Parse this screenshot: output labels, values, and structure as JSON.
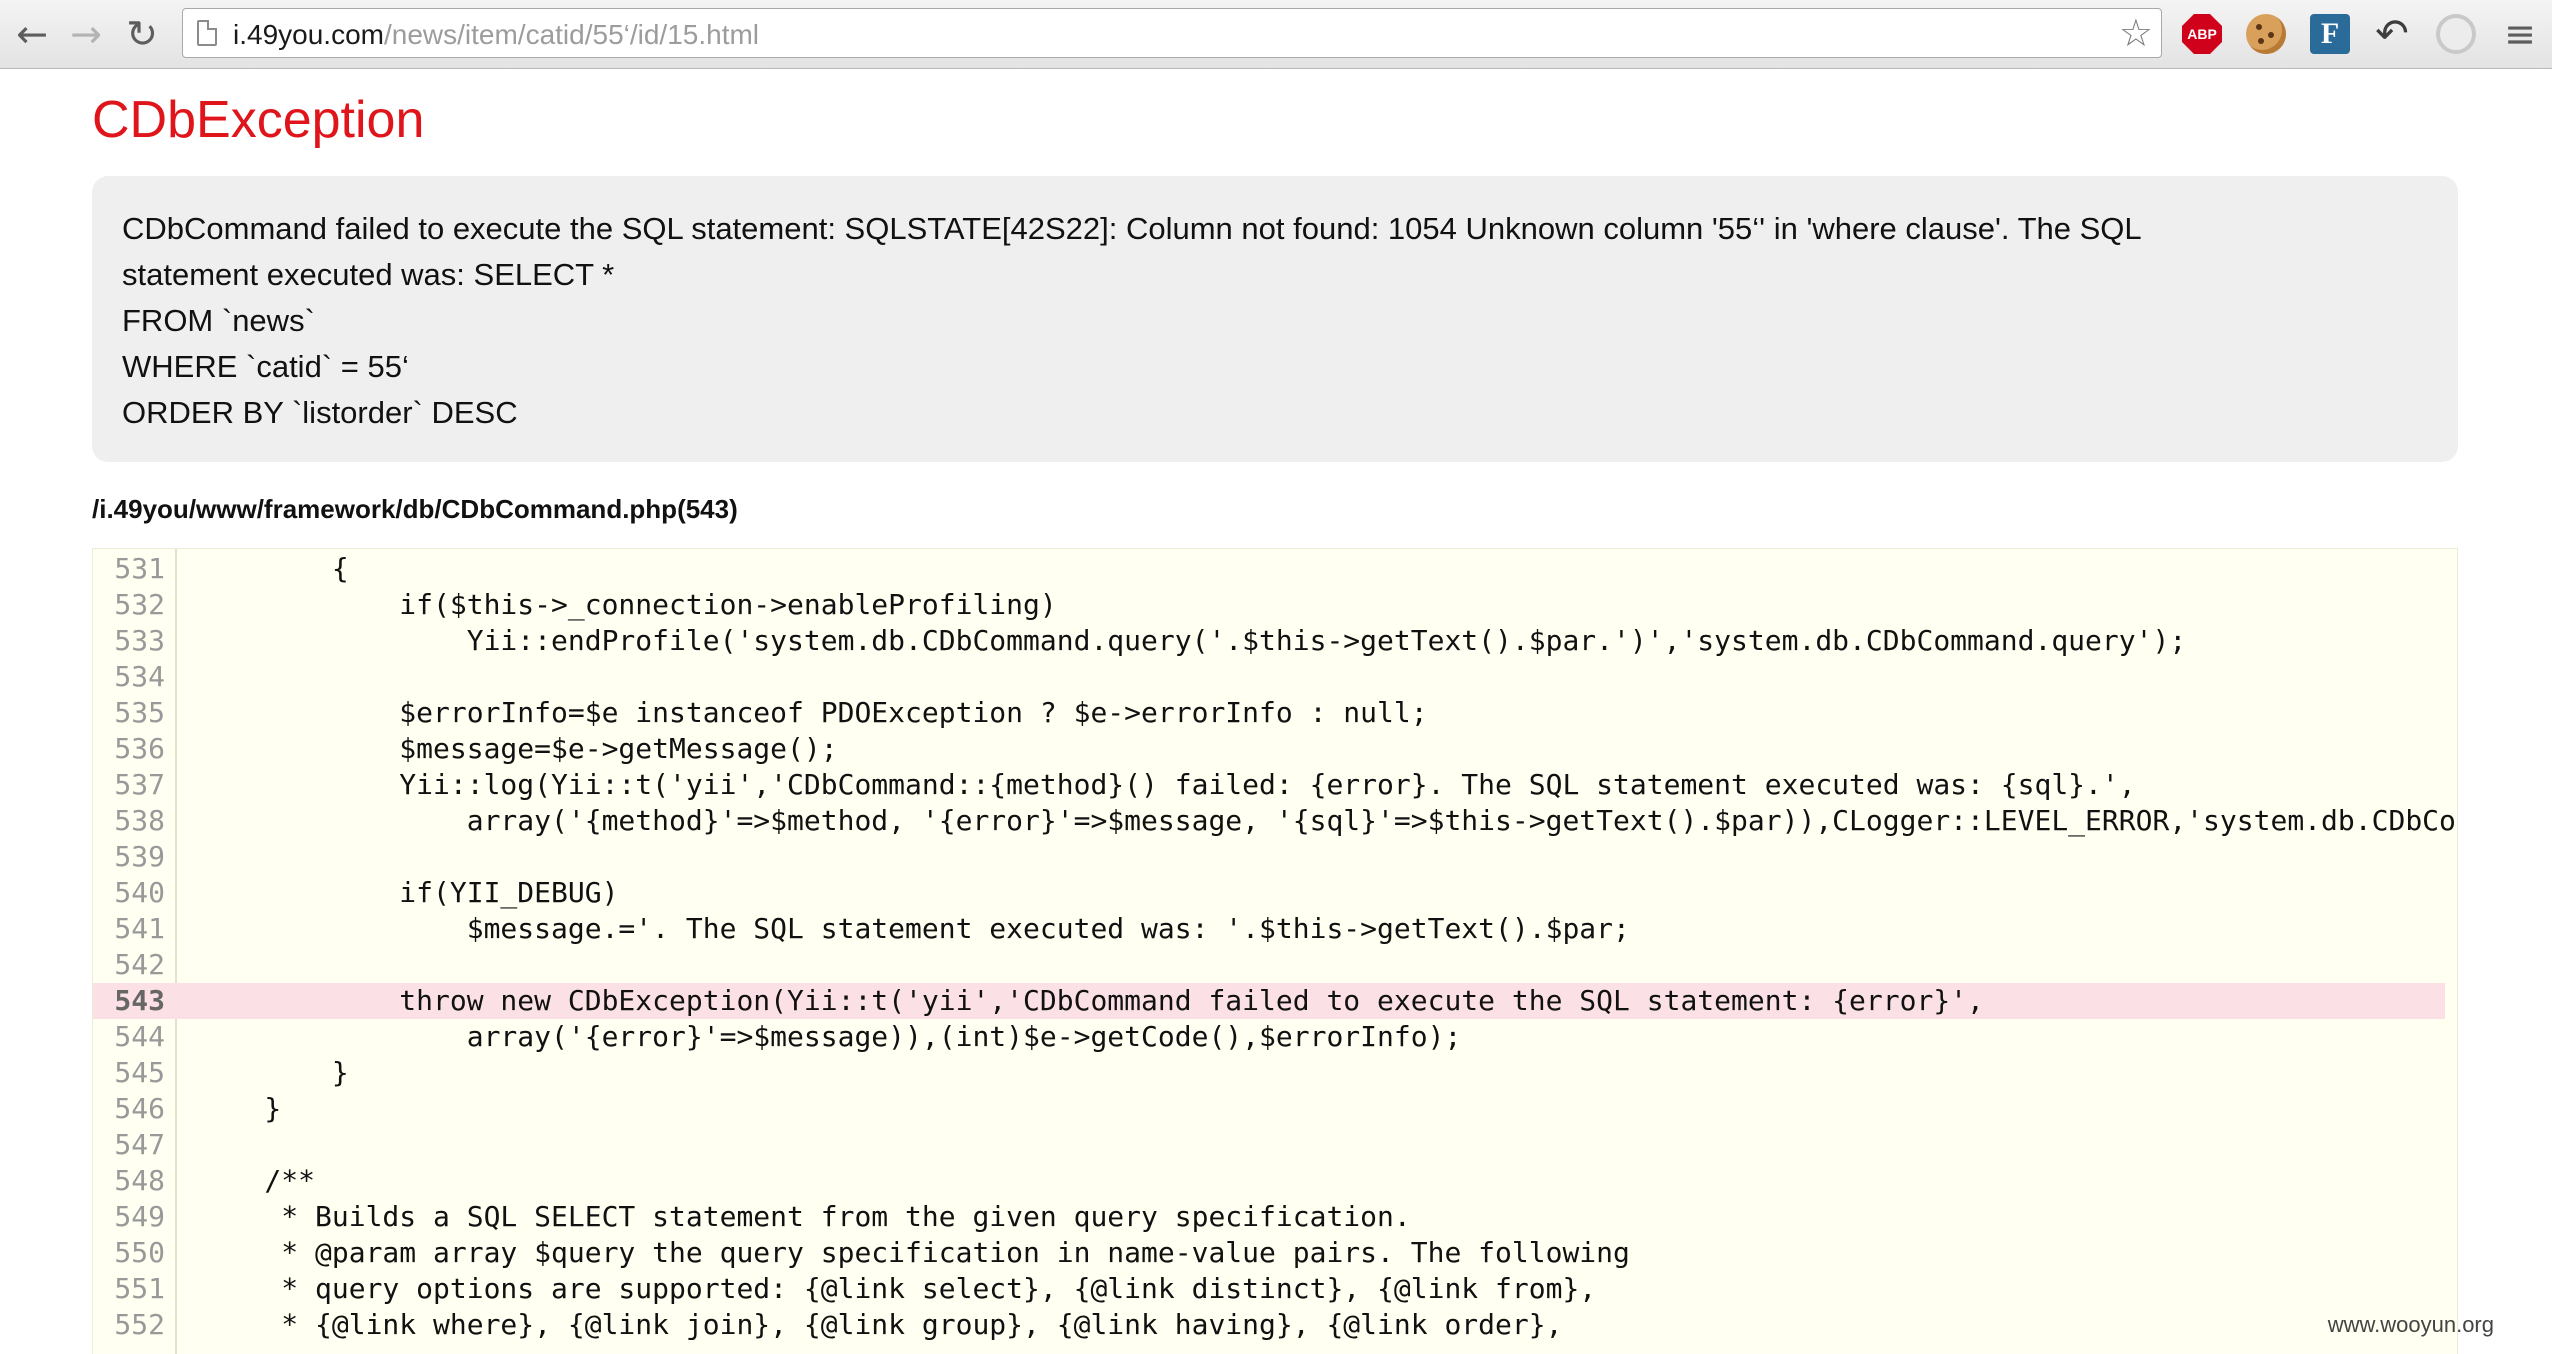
{
  "browser": {
    "back_icon": "←",
    "forward_icon": "→",
    "reload_icon": "↻",
    "url_host": "i.49you.com",
    "url_path": "/news/item/catid/55‘/id/15.html",
    "star_icon": "☆",
    "extensions": {
      "adblock_label": "ABP",
      "feedly_label": "F",
      "refresh_glyph": "↶",
      "menu_glyph": "≡"
    }
  },
  "error": {
    "title": "CDbException",
    "message_lines": [
      "CDbCommand failed to execute the SQL statement: SQLSTATE[42S22]: Column not found: 1054 Unknown column '55‘' in 'where clause'. The SQL",
      "statement executed was: SELECT *",
      "FROM `news`",
      "WHERE `catid` = 55‘",
      "ORDER BY `listorder` DESC"
    ],
    "file": "/i.49you/www/framework/db/CDbCommand.php(543)"
  },
  "source": {
    "highlight_line": "543",
    "lines": [
      {
        "num": "531",
        "code": "        {"
      },
      {
        "num": "532",
        "code": "            if($this->_connection->enableProfiling)"
      },
      {
        "num": "533",
        "code": "                Yii::endProfile('system.db.CDbCommand.query('.$this->getText().$par.')','system.db.CDbCommand.query');"
      },
      {
        "num": "534",
        "code": ""
      },
      {
        "num": "535",
        "code": "            $errorInfo=$e instanceof PDOException ? $e->errorInfo : null;"
      },
      {
        "num": "536",
        "code": "            $message=$e->getMessage();"
      },
      {
        "num": "537",
        "code": "            Yii::log(Yii::t('yii','CDbCommand::{method}() failed: {error}. The SQL statement executed was: {sql}.',"
      },
      {
        "num": "538",
        "code": "                array('{method}'=>$method, '{error}'=>$message, '{sql}'=>$this->getText().$par)),CLogger::LEVEL_ERROR,'system.db.CDbCo"
      },
      {
        "num": "539",
        "code": ""
      },
      {
        "num": "540",
        "code": "            if(YII_DEBUG)"
      },
      {
        "num": "541",
        "code": "                $message.='. The SQL statement executed was: '.$this->getText().$par;"
      },
      {
        "num": "542",
        "code": ""
      },
      {
        "num": "543",
        "code": "            throw new CDbException(Yii::t('yii','CDbCommand failed to execute the SQL statement: {error}',"
      },
      {
        "num": "544",
        "code": "                array('{error}'=>$message)),(int)$e->getCode(),$errorInfo);"
      },
      {
        "num": "545",
        "code": "        }"
      },
      {
        "num": "546",
        "code": "    }"
      },
      {
        "num": "547",
        "code": ""
      },
      {
        "num": "548",
        "code": "    /**"
      },
      {
        "num": "549",
        "code": "     * Builds a SQL SELECT statement from the given query specification."
      },
      {
        "num": "550",
        "code": "     * @param array $query the query specification in name-value pairs. The following"
      },
      {
        "num": "551",
        "code": "     * query options are supported: {@link select}, {@link distinct}, {@link from},"
      },
      {
        "num": "552",
        "code": "     * {@link where}, {@link join}, {@link group}, {@link having}, {@link order},"
      }
    ]
  },
  "watermark": "www.wooyun.org"
}
